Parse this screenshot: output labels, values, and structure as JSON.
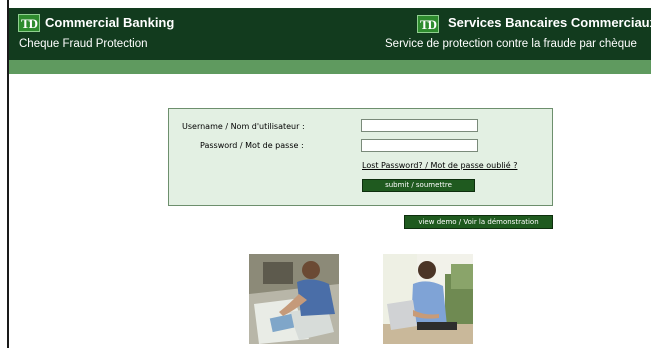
{
  "header": {
    "logo_text": "TD",
    "title_en": "Commercial Banking",
    "title_fr": "Services Bancaires Commerciaux",
    "subtitle_en": "Cheque Fraud Protection",
    "subtitle_fr": "Service de protection contre la fraude par chèque"
  },
  "login": {
    "username_label": "Username / Nom d'utilisateur :",
    "password_label": "Password / Mot de passe :",
    "username_value": "",
    "password_value": "",
    "lost_password_link": "Lost Password? / Mot de passe oublié ?",
    "submit_label": "submit / soumettre"
  },
  "demo": {
    "button_label": "view demo / Voir la démonstration"
  },
  "colors": {
    "header_bg": "#123b1e",
    "accent_bar": "#5f9a5f",
    "panel_bg": "#e3f0e3",
    "button_bg": "#1f5a1f"
  },
  "icons": {
    "logo": "td-logo-icon",
    "photo_left": "person-at-desk-photo",
    "photo_right": "person-with-laptop-photo"
  }
}
